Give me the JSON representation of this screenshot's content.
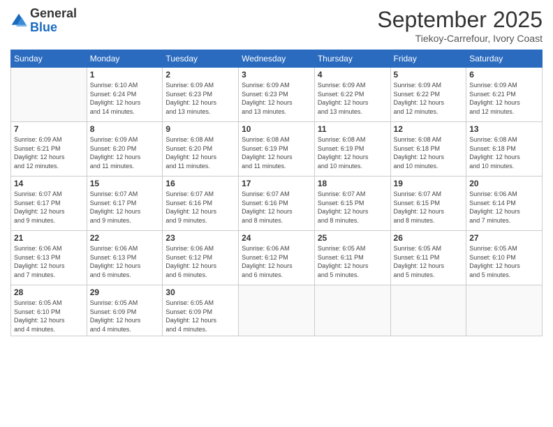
{
  "logo": {
    "general": "General",
    "blue": "Blue"
  },
  "header": {
    "month": "September 2025",
    "location": "Tiekoу-Carrefour, Ivory Coast"
  },
  "weekdays": [
    "Sunday",
    "Monday",
    "Tuesday",
    "Wednesday",
    "Thursday",
    "Friday",
    "Saturday"
  ],
  "weeks": [
    [
      {
        "day": "",
        "info": ""
      },
      {
        "day": "1",
        "info": "Sunrise: 6:10 AM\nSunset: 6:24 PM\nDaylight: 12 hours\nand 14 minutes."
      },
      {
        "day": "2",
        "info": "Sunrise: 6:09 AM\nSunset: 6:23 PM\nDaylight: 12 hours\nand 13 minutes."
      },
      {
        "day": "3",
        "info": "Sunrise: 6:09 AM\nSunset: 6:23 PM\nDaylight: 12 hours\nand 13 minutes."
      },
      {
        "day": "4",
        "info": "Sunrise: 6:09 AM\nSunset: 6:22 PM\nDaylight: 12 hours\nand 13 minutes."
      },
      {
        "day": "5",
        "info": "Sunrise: 6:09 AM\nSunset: 6:22 PM\nDaylight: 12 hours\nand 12 minutes."
      },
      {
        "day": "6",
        "info": "Sunrise: 6:09 AM\nSunset: 6:21 PM\nDaylight: 12 hours\nand 12 minutes."
      }
    ],
    [
      {
        "day": "7",
        "info": "Sunrise: 6:09 AM\nSunset: 6:21 PM\nDaylight: 12 hours\nand 12 minutes."
      },
      {
        "day": "8",
        "info": "Sunrise: 6:09 AM\nSunset: 6:20 PM\nDaylight: 12 hours\nand 11 minutes."
      },
      {
        "day": "9",
        "info": "Sunrise: 6:08 AM\nSunset: 6:20 PM\nDaylight: 12 hours\nand 11 minutes."
      },
      {
        "day": "10",
        "info": "Sunrise: 6:08 AM\nSunset: 6:19 PM\nDaylight: 12 hours\nand 11 minutes."
      },
      {
        "day": "11",
        "info": "Sunrise: 6:08 AM\nSunset: 6:19 PM\nDaylight: 12 hours\nand 10 minutes."
      },
      {
        "day": "12",
        "info": "Sunrise: 6:08 AM\nSunset: 6:18 PM\nDaylight: 12 hours\nand 10 minutes."
      },
      {
        "day": "13",
        "info": "Sunrise: 6:08 AM\nSunset: 6:18 PM\nDaylight: 12 hours\nand 10 minutes."
      }
    ],
    [
      {
        "day": "14",
        "info": "Sunrise: 6:07 AM\nSunset: 6:17 PM\nDaylight: 12 hours\nand 9 minutes."
      },
      {
        "day": "15",
        "info": "Sunrise: 6:07 AM\nSunset: 6:17 PM\nDaylight: 12 hours\nand 9 minutes."
      },
      {
        "day": "16",
        "info": "Sunrise: 6:07 AM\nSunset: 6:16 PM\nDaylight: 12 hours\nand 9 minutes."
      },
      {
        "day": "17",
        "info": "Sunrise: 6:07 AM\nSunset: 6:16 PM\nDaylight: 12 hours\nand 8 minutes."
      },
      {
        "day": "18",
        "info": "Sunrise: 6:07 AM\nSunset: 6:15 PM\nDaylight: 12 hours\nand 8 minutes."
      },
      {
        "day": "19",
        "info": "Sunrise: 6:07 AM\nSunset: 6:15 PM\nDaylight: 12 hours\nand 8 minutes."
      },
      {
        "day": "20",
        "info": "Sunrise: 6:06 AM\nSunset: 6:14 PM\nDaylight: 12 hours\nand 7 minutes."
      }
    ],
    [
      {
        "day": "21",
        "info": "Sunrise: 6:06 AM\nSunset: 6:13 PM\nDaylight: 12 hours\nand 7 minutes."
      },
      {
        "day": "22",
        "info": "Sunrise: 6:06 AM\nSunset: 6:13 PM\nDaylight: 12 hours\nand 6 minutes."
      },
      {
        "day": "23",
        "info": "Sunrise: 6:06 AM\nSunset: 6:12 PM\nDaylight: 12 hours\nand 6 minutes."
      },
      {
        "day": "24",
        "info": "Sunrise: 6:06 AM\nSunset: 6:12 PM\nDaylight: 12 hours\nand 6 minutes."
      },
      {
        "day": "25",
        "info": "Sunrise: 6:05 AM\nSunset: 6:11 PM\nDaylight: 12 hours\nand 5 minutes."
      },
      {
        "day": "26",
        "info": "Sunrise: 6:05 AM\nSunset: 6:11 PM\nDaylight: 12 hours\nand 5 minutes."
      },
      {
        "day": "27",
        "info": "Sunrise: 6:05 AM\nSunset: 6:10 PM\nDaylight: 12 hours\nand 5 minutes."
      }
    ],
    [
      {
        "day": "28",
        "info": "Sunrise: 6:05 AM\nSunset: 6:10 PM\nDaylight: 12 hours\nand 4 minutes."
      },
      {
        "day": "29",
        "info": "Sunrise: 6:05 AM\nSunset: 6:09 PM\nDaylight: 12 hours\nand 4 minutes."
      },
      {
        "day": "30",
        "info": "Sunrise: 6:05 AM\nSunset: 6:09 PM\nDaylight: 12 hours\nand 4 minutes."
      },
      {
        "day": "",
        "info": ""
      },
      {
        "day": "",
        "info": ""
      },
      {
        "day": "",
        "info": ""
      },
      {
        "day": "",
        "info": ""
      }
    ]
  ]
}
